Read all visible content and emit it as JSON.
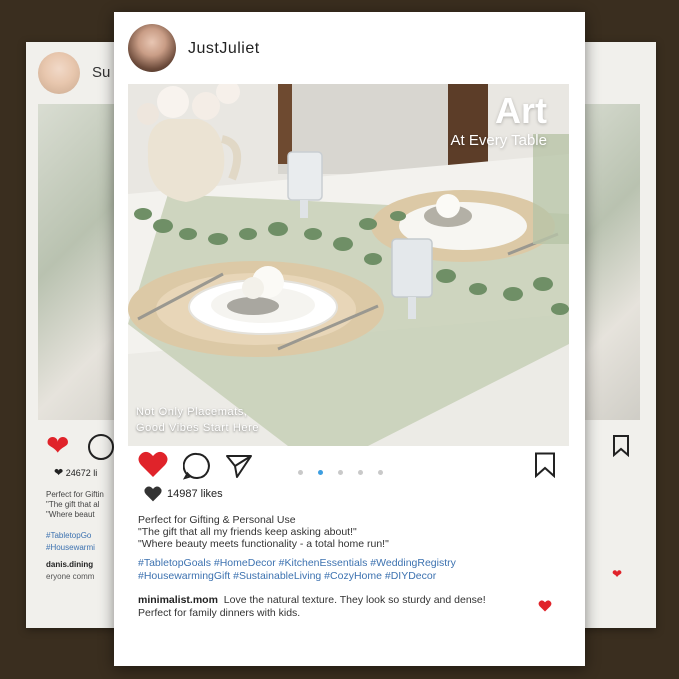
{
  "background_posts": {
    "left": {
      "username": "Su",
      "likes": "24672 li",
      "caption": "Perfect for Giftin\n\"The gift that al\n\"Where beaut",
      "hashtags": "#TabletopGo\n#Housewarmi",
      "comment_user": "danis.dining",
      "comment_text": "eryone comm"
    }
  },
  "post": {
    "username": "JustJuliet",
    "image": {
      "title": "Art",
      "subtitle": "At Every Table",
      "caption": "Not Only Placemats,\nGood Vibes Start Here"
    },
    "carousel": {
      "count": 5,
      "active_index": 1
    },
    "likes": "14987 likes",
    "caption_lines": [
      "Perfect for Gifting & Personal Use",
      "\"The gift that all my friends keep asking about!\"",
      "\"Where beauty meets functionality - a total home run!\""
    ],
    "hashtags_line1": "#TabletopGoals #HomeDecor #KitchenEssentials #WeddingRegistry",
    "hashtags_line2": "#HousewarmingGift #SustainableLiving #CozyHome #DIYDecor",
    "comment": {
      "user": "minimalist.mom",
      "text": "Love the natural texture. They look so sturdy and dense! Perfect for family dinners with kids."
    }
  },
  "colors": {
    "like_red": "#e0232a",
    "hashtag_blue": "#3d72b0",
    "active_dot": "#3d9ee0",
    "background_brown": "#3a2e1f"
  },
  "icons": [
    "heart-icon",
    "comment-icon",
    "share-icon",
    "bookmark-icon"
  ]
}
